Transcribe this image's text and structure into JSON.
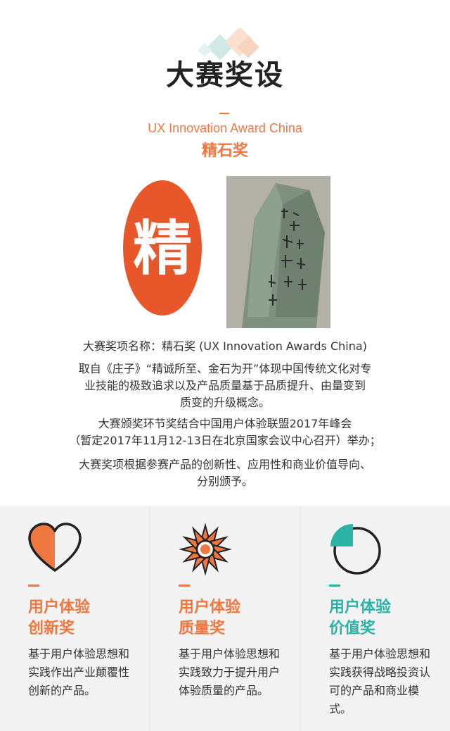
{
  "header": {
    "title": "大赛奖设",
    "subtitle_en": "UX Innovation Award China",
    "subtitle_cn": "精石奖"
  },
  "seal": {
    "glyph": "精"
  },
  "description": {
    "award_name": "大赛奖项名称：精石奖 (UX Innovation Awards China)",
    "origin_line1": "取自《庄子》“精诚所至、金石为开”体现中国传统文化对专",
    "origin_line2": "业技能的极致追求以及产品质量基于品质提升、由量变到",
    "origin_line3": "质变的升级概念。",
    "ceremony_line1": "大赛颁奖环节奖结合中国用户体验联盟2017年峰会",
    "ceremony_line2": "（暂定2017年11月12-13日在北京国家会议中心召开）举办；",
    "criteria_line1": "大赛奖项根据参赛产品的创新性、应用性和商业价值导向、",
    "criteria_line2": "分别颁予。"
  },
  "awards": [
    {
      "title_line1": "用户体验",
      "title_line2": "创新奖",
      "color": "#f07840",
      "icon": "heart-icon",
      "desc": "基于用户体验思想和实践作出产业颠覆性创新的产品。"
    },
    {
      "title_line1": "用户体验",
      "title_line2": "质量奖",
      "color": "#f07840",
      "icon": "flower-icon",
      "desc": "基于用户体验思想和实践致力于提升用户体验质量的产品。"
    },
    {
      "title_line1": "用户体验",
      "title_line2": "价值奖",
      "color": "#2bb3a6",
      "icon": "pie-chart-icon",
      "desc": "基于用户体验思想和实践获得战略投资认可的产品和商业模式。"
    }
  ]
}
